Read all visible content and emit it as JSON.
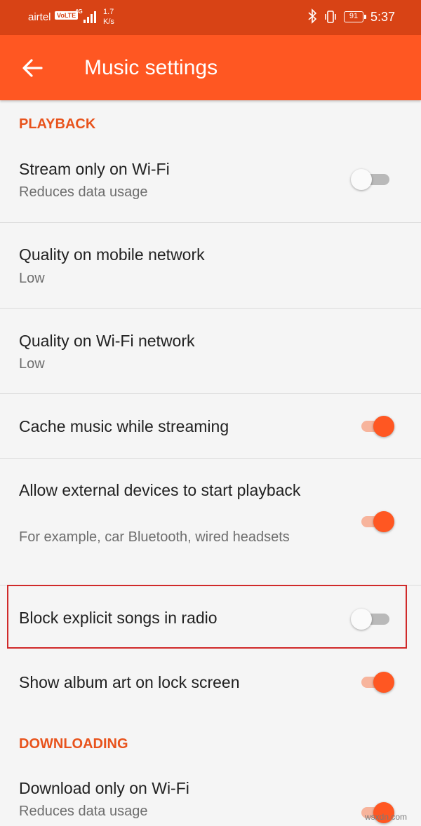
{
  "status_bar": {
    "carrier": "airtel",
    "volte": "VoLTE",
    "network": "4G",
    "speed_value": "1.7",
    "speed_unit": "K/s",
    "battery": "91",
    "time": "5:37"
  },
  "app_bar": {
    "title": "Music settings",
    "back_icon": "arrow-back-icon",
    "color": "#ff5722"
  },
  "sections": {
    "playback": "PLAYBACK",
    "downloading": "DOWNLOADING"
  },
  "settings": {
    "stream_wifi": {
      "title": "Stream only on Wi-Fi",
      "summary": "Reduces data usage",
      "enabled": false
    },
    "quality_mobile": {
      "title": "Quality on mobile network",
      "summary": "Low"
    },
    "quality_wifi": {
      "title": "Quality on Wi-Fi network",
      "summary": "Low"
    },
    "cache_music": {
      "title": "Cache music while streaming",
      "enabled": true
    },
    "external_devices": {
      "title": "Allow external devices to start playback",
      "summary": "For example, car Bluetooth, wired headsets",
      "enabled": true
    },
    "block_explicit": {
      "title": "Block explicit songs in radio",
      "enabled": false
    },
    "album_art": {
      "title": "Show album art on lock screen",
      "enabled": true
    },
    "download_wifi": {
      "title": "Download only on Wi-Fi",
      "summary": "Reduces data usage",
      "enabled": true
    }
  },
  "colors": {
    "accent": "#ff5722",
    "status_bar": "#d84315",
    "section_header": "#e8531c",
    "highlight_box": "#d02a2a"
  },
  "watermark": "wsxdn.com"
}
